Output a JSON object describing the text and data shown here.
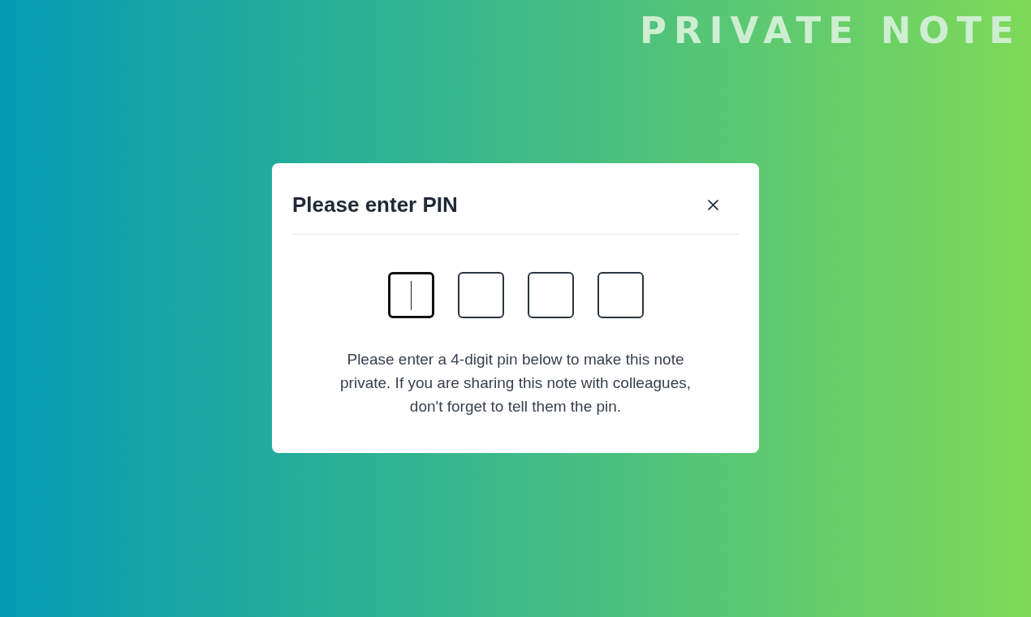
{
  "page": {
    "heading": "PRIVATE NOTE"
  },
  "dialog": {
    "title": "Please enter PIN",
    "pin_fields": [
      {
        "focused": true
      },
      {
        "focused": false
      },
      {
        "focused": false
      },
      {
        "focused": false
      }
    ],
    "message": "Please enter a 4-digit pin below to make this note private. If you are sharing this note with colleagues, don't forget to tell them the pin."
  }
}
